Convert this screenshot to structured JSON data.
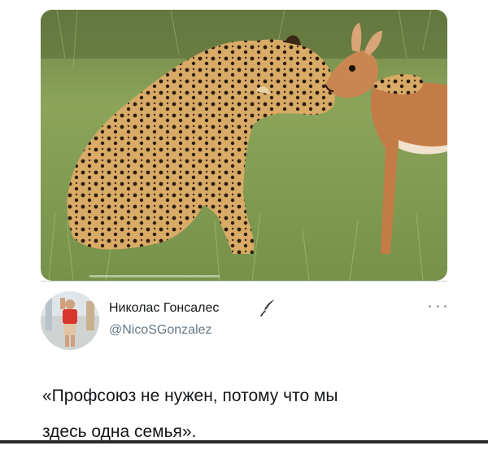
{
  "tweet": {
    "photo_icon": "leopard-and-impala-photo",
    "author": {
      "name": "Николас Гонсалес",
      "handle": "@NicoSGonzalez",
      "badge_icon": "feather-icon"
    },
    "more_icon": "more-dots-icon",
    "text_lines": [
      "«Профсоюз не нужен, потому что мы",
      "здесь одна семья»."
    ]
  },
  "colors": {
    "text": "#14171a",
    "handle": "#657786",
    "grass": "#7e9a4c",
    "leopard": "#d7a862",
    "impala": "#c07a43"
  }
}
